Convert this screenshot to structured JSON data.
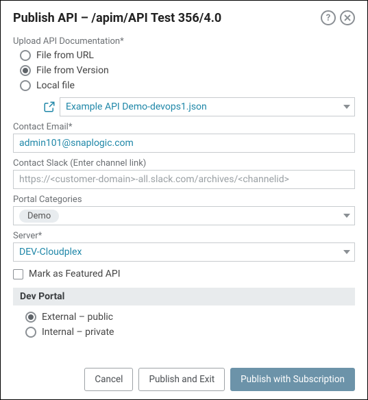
{
  "header": {
    "title": "Publish API – /apim/API Test 356/4.0"
  },
  "upload": {
    "label": "Upload API Documentation*",
    "options": [
      {
        "label": "File from URL",
        "checked": false
      },
      {
        "label": "File from Version",
        "checked": true
      },
      {
        "label": "Local file",
        "checked": false
      }
    ],
    "filename": "Example API Demo-devops1.json"
  },
  "contactEmail": {
    "label": "Contact Email*",
    "value": "admin101@snaplogic.com"
  },
  "contactSlack": {
    "label": "Contact Slack (Enter channel link)",
    "placeholder": "https://<customer-domain>-all.slack.com/archives/<channelid>"
  },
  "portalCategories": {
    "label": "Portal Categories",
    "chip": "Demo"
  },
  "server": {
    "label": "Server*",
    "value": "DEV-Cloudplex"
  },
  "featured": {
    "label": "Mark as Featured API",
    "checked": false
  },
  "devPortal": {
    "heading": "Dev Portal",
    "options": [
      {
        "label": "External – public",
        "checked": true
      },
      {
        "label": "Internal – private",
        "checked": false
      }
    ]
  },
  "buttons": {
    "cancel": "Cancel",
    "publishExit": "Publish and Exit",
    "publishSub": "Publish with Subscription"
  }
}
